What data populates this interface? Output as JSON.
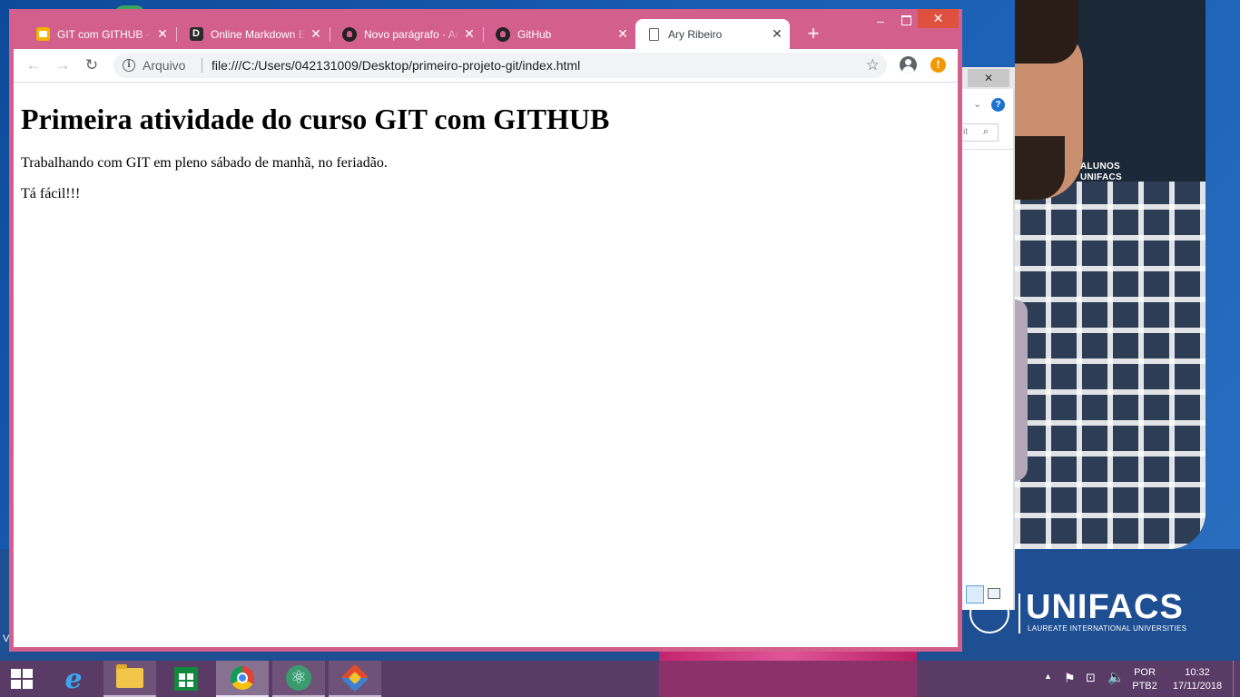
{
  "browser": {
    "tabs": [
      {
        "title": "GIT com GITHUB - A",
        "icon": "slides-icon"
      },
      {
        "title": "Online Markdown E",
        "icon": "dillinger-icon"
      },
      {
        "title": "Novo parágrafo · Ar",
        "icon": "github-icon"
      },
      {
        "title": "GitHub",
        "icon": "github-icon"
      },
      {
        "title": "Ary Ribeiro",
        "icon": "document-icon",
        "active": true
      }
    ],
    "new_tab": "+",
    "close_glyph": "✕",
    "omnibox": {
      "chip_label": "Arquivo",
      "url": "file:///C:/Users/042131009/Desktop/primeiro-projeto-git/index.html"
    }
  },
  "page": {
    "heading": "Primeira atividade do curso GIT com GITHUB",
    "paragraphs": [
      "Trabalhando com GIT em pleno sábado de manhã, no feriadão.",
      "Tá fácil!!!"
    ]
  },
  "desktop": {
    "wallpaper_brand": "UNIFACS",
    "wallpaper_tagline": "LAUREATE INTERNATIONAL UNIVERSITIES",
    "wallpaper_badge_line1": "ALUNOS",
    "wallpaper_badge_line2": "UNIFACS",
    "explorer_search_fragment": "it",
    "stray_text": "V"
  },
  "taskbar": {
    "apps": [
      "internet-explorer",
      "file-explorer",
      "windows-store",
      "google-chrome",
      "atom",
      "git-gui"
    ],
    "tray": {
      "language_line1": "POR",
      "language_line2": "PTB2",
      "time": "10:32",
      "date": "17/11/2018"
    }
  },
  "colors": {
    "chrome_frame": "#d35f8d",
    "taskbar": "#5a3b66",
    "window_close": "#e0503e"
  }
}
